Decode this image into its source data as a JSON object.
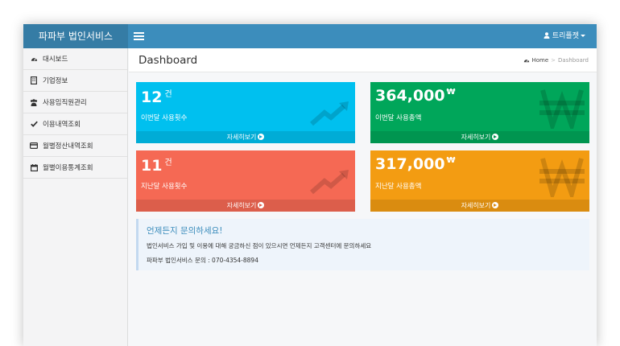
{
  "brand": "파파부 법인서비스",
  "user": {
    "name": "트리플젯"
  },
  "sidebar": {
    "items": [
      {
        "label": "대시보드",
        "icon": "dashboard-icon"
      },
      {
        "label": "기업정보",
        "icon": "building-icon"
      },
      {
        "label": "사용임직원관리",
        "icon": "users-icon"
      },
      {
        "label": "이용내역조회",
        "icon": "check-icon"
      },
      {
        "label": "월별정산내역조회",
        "icon": "credit-card-icon"
      },
      {
        "label": "월별이용통계조회",
        "icon": "calendar-icon"
      }
    ]
  },
  "header": {
    "title": "Dashboard",
    "breadcrumb": {
      "home": "Home",
      "current": "Dashboard"
    }
  },
  "boxes": [
    {
      "value": "12",
      "unit": "건",
      "label": "이번달 사용횟수",
      "more": "자세히보기",
      "color": "#00c0ef",
      "icon": "trend-up-icon"
    },
    {
      "value": "364,000",
      "unit": "₩",
      "label": "이번달 사용총액",
      "more": "자세히보기",
      "color": "#00a65a",
      "icon": "won-icon"
    },
    {
      "value": "11",
      "unit": "건",
      "label": "지난달 사용횟수",
      "more": "자세히보기",
      "color": "#f56954",
      "icon": "trend-up-icon"
    },
    {
      "value": "317,000",
      "unit": "₩",
      "label": "지난달 사용총액",
      "more": "자세히보기",
      "color": "#f39c12",
      "icon": "won-icon"
    }
  ],
  "callout": {
    "title": "언제든지 문의하세요!",
    "line1": "법인서비스 가입 및 이용에 대해 궁금하신 점이 있으시면 언제든지 고객센터에 문의하세요",
    "line2": "파파부 법인서비스 문의 : 070-4354-8894"
  }
}
